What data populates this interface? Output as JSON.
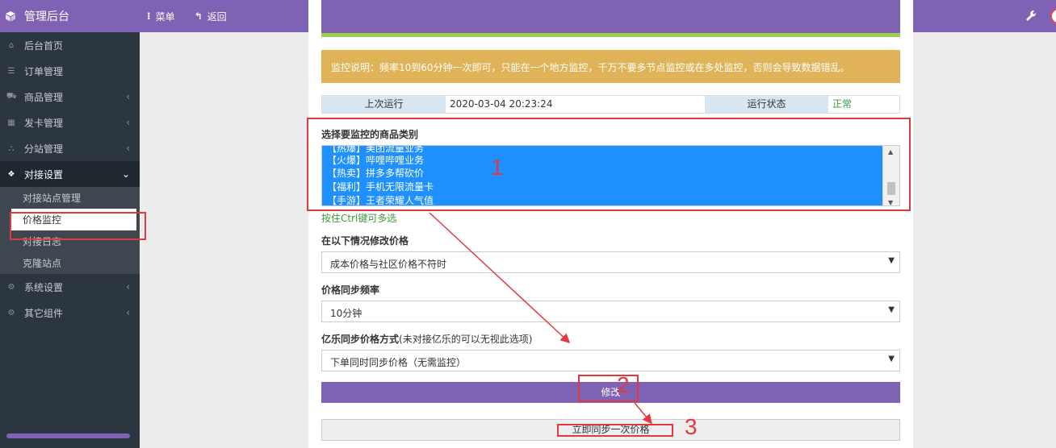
{
  "header": {
    "brand": "管理后台",
    "menu_label": "菜单",
    "back_label": "返回",
    "brand_icon": "cube-icon",
    "settings_icon": "wrench-icon"
  },
  "sidebar": {
    "items": [
      {
        "label": "后台首页",
        "icon": "home-icon"
      },
      {
        "label": "订单管理",
        "icon": "list-icon"
      },
      {
        "label": "商品管理",
        "icon": "cart-icon"
      },
      {
        "label": "发卡管理",
        "icon": "grid-icon"
      },
      {
        "label": "分站管理",
        "icon": "sitemap-icon"
      },
      {
        "label": "对接设置",
        "icon": "cubes-icon"
      },
      {
        "label": "系统设置",
        "icon": "gear-icon"
      },
      {
        "label": "其它组件",
        "icon": "gears-icon"
      }
    ],
    "submenu": [
      "对接站点管理",
      "价格监控",
      "对接日志",
      "克隆站点"
    ]
  },
  "main": {
    "alert": "监控说明：频率10到60分钟一次即可，只能在一个地方监控，千万不要多节点监控或在多处监控，否则会导致数据错乱。",
    "run_table": {
      "last_run_label": "上次运行",
      "last_run_value": "2020-03-04 20:23:24",
      "status_label": "运行状态",
      "status_value": "正常"
    },
    "category_label": "选择要监控的商品类别",
    "categories": [
      "【热爆】美团流量业务",
      "【火爆】哔哩哔哩业务",
      "【热卖】拼多多帮砍价",
      "【福利】手机无限流量卡",
      "【手游】王者荣耀人气值"
    ],
    "multi_hint": "按住Ctrl键可多选",
    "condition_label": "在以下情况修改价格",
    "condition_value": "成本价格与社区价格不符时",
    "frequency_label": "价格同步频率",
    "frequency_value": "10分钟",
    "yile_label": "亿乐同步价格方式",
    "yile_note": "(未对接亿乐的可以无视此选项)",
    "yile_value": "下单同时同步价格（无需监控）",
    "modify_button": "修改",
    "sync_button": "立即同步一次价格"
  },
  "annotations": [
    "1",
    "2",
    "3"
  ],
  "colors": {
    "accent": "#7f62b3",
    "sidebar": "#2c3640",
    "alert": "#e1b358",
    "highlight": "#e0393e",
    "selection": "#1e90ff"
  }
}
